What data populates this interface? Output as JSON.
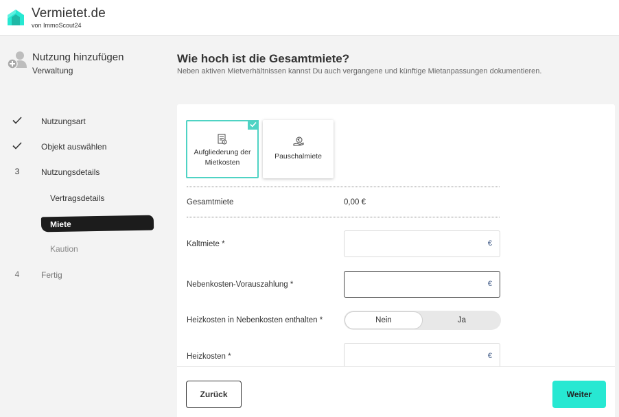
{
  "header": {
    "brand": "Vermietet.de",
    "brand_sub": "von ImmoScout24",
    "accent_color": "#27e8d2"
  },
  "sidebar": {
    "title": "Nutzung hinzufügen",
    "subtitle": "Verwaltung",
    "steps": [
      {
        "marker": "check-icon",
        "label": "Nutzungsart"
      },
      {
        "marker": "check-icon",
        "label": "Objekt auswählen"
      },
      {
        "marker": "3",
        "label": "Nutzungsdetails"
      },
      {
        "marker": "4",
        "label": "Fertig"
      }
    ],
    "substeps": [
      {
        "label": "Vertragsdetails"
      },
      {
        "label": "Miete",
        "active": true
      },
      {
        "label": "Kaution"
      }
    ]
  },
  "main": {
    "title": "Wie hoch ist die Gesamtmiete?",
    "subtitle": "Neben aktiven Mietverhältnissen kannst Du auch vergangene und künftige Mietanpassungen dokumentieren."
  },
  "options": [
    {
      "label_line1": "Aufgliederung der",
      "label_line2": "Mietkosten",
      "selected": true,
      "icon": "receipt-icon"
    },
    {
      "label": "Pauschalmiete",
      "selected": false,
      "icon": "euro-hand-icon"
    }
  ],
  "form": {
    "total_label": "Gesamtmiete",
    "total_value": "0,00 €",
    "kaltmiete_label": "Kaltmiete *",
    "nebenkosten_label": "Nebenkosten-Vorauszahlung *",
    "heizkosten_included_label": "Heizkosten in Nebenkosten enthalten *",
    "toggle_options": [
      "Nein",
      "Ja"
    ],
    "toggle_selected": "Nein",
    "heizkosten_label": "Heizkosten *",
    "currency_symbol": "€"
  },
  "footer": {
    "back_label": "Zurück",
    "next_label": "Weiter"
  }
}
